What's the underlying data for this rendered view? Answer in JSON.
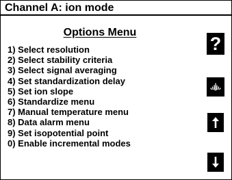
{
  "header": {
    "title": "Channel A: ion mode"
  },
  "menu": {
    "title": "Options Menu",
    "items": [
      "1) Select resolution",
      "2) Select stability criteria",
      "3) Select signal averaging",
      "4) Set standardization delay",
      "5) Set ion slope",
      "6) Standardize menu",
      "7) Manual temperature menu",
      "8) Data alarm menu",
      "9) Set isopotential point",
      "0) Enable incremental modes"
    ]
  },
  "softkeys": {
    "help_label": "?",
    "help_icon": "question-mark-icon",
    "stability_icon": "stability-signal-icon",
    "up_icon": "arrow-up-icon",
    "down_icon": "arrow-down-icon"
  },
  "colors": {
    "foreground": "#000000",
    "background": "#ffffff"
  }
}
